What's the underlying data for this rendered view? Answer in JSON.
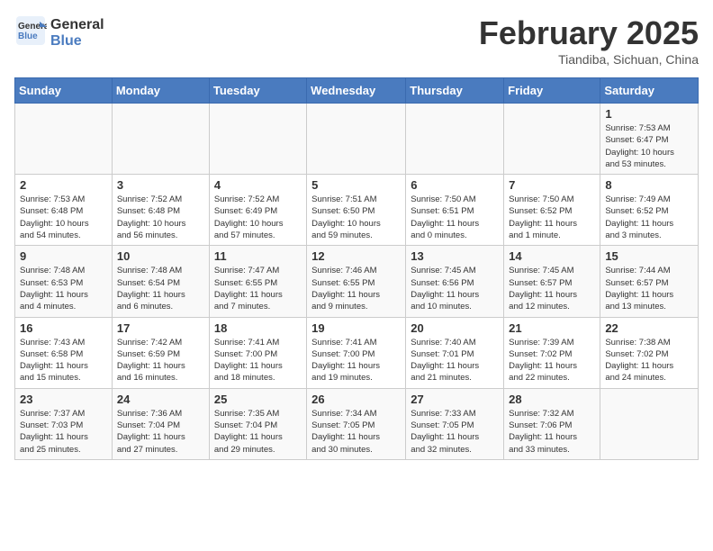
{
  "header": {
    "logo_line1": "General",
    "logo_line2": "Blue",
    "title": "February 2025",
    "subtitle": "Tiandiba, Sichuan, China"
  },
  "days_of_week": [
    "Sunday",
    "Monday",
    "Tuesday",
    "Wednesday",
    "Thursday",
    "Friday",
    "Saturday"
  ],
  "weeks": [
    [
      {
        "day": "",
        "info": ""
      },
      {
        "day": "",
        "info": ""
      },
      {
        "day": "",
        "info": ""
      },
      {
        "day": "",
        "info": ""
      },
      {
        "day": "",
        "info": ""
      },
      {
        "day": "",
        "info": ""
      },
      {
        "day": "1",
        "info": "Sunrise: 7:53 AM\nSunset: 6:47 PM\nDaylight: 10 hours\nand 53 minutes."
      }
    ],
    [
      {
        "day": "2",
        "info": "Sunrise: 7:53 AM\nSunset: 6:48 PM\nDaylight: 10 hours\nand 54 minutes."
      },
      {
        "day": "3",
        "info": "Sunrise: 7:52 AM\nSunset: 6:48 PM\nDaylight: 10 hours\nand 56 minutes."
      },
      {
        "day": "4",
        "info": "Sunrise: 7:52 AM\nSunset: 6:49 PM\nDaylight: 10 hours\nand 57 minutes."
      },
      {
        "day": "5",
        "info": "Sunrise: 7:51 AM\nSunset: 6:50 PM\nDaylight: 10 hours\nand 59 minutes."
      },
      {
        "day": "6",
        "info": "Sunrise: 7:50 AM\nSunset: 6:51 PM\nDaylight: 11 hours\nand 0 minutes."
      },
      {
        "day": "7",
        "info": "Sunrise: 7:50 AM\nSunset: 6:52 PM\nDaylight: 11 hours\nand 1 minute."
      },
      {
        "day": "8",
        "info": "Sunrise: 7:49 AM\nSunset: 6:52 PM\nDaylight: 11 hours\nand 3 minutes."
      }
    ],
    [
      {
        "day": "9",
        "info": "Sunrise: 7:48 AM\nSunset: 6:53 PM\nDaylight: 11 hours\nand 4 minutes."
      },
      {
        "day": "10",
        "info": "Sunrise: 7:48 AM\nSunset: 6:54 PM\nDaylight: 11 hours\nand 6 minutes."
      },
      {
        "day": "11",
        "info": "Sunrise: 7:47 AM\nSunset: 6:55 PM\nDaylight: 11 hours\nand 7 minutes."
      },
      {
        "day": "12",
        "info": "Sunrise: 7:46 AM\nSunset: 6:55 PM\nDaylight: 11 hours\nand 9 minutes."
      },
      {
        "day": "13",
        "info": "Sunrise: 7:45 AM\nSunset: 6:56 PM\nDaylight: 11 hours\nand 10 minutes."
      },
      {
        "day": "14",
        "info": "Sunrise: 7:45 AM\nSunset: 6:57 PM\nDaylight: 11 hours\nand 12 minutes."
      },
      {
        "day": "15",
        "info": "Sunrise: 7:44 AM\nSunset: 6:57 PM\nDaylight: 11 hours\nand 13 minutes."
      }
    ],
    [
      {
        "day": "16",
        "info": "Sunrise: 7:43 AM\nSunset: 6:58 PM\nDaylight: 11 hours\nand 15 minutes."
      },
      {
        "day": "17",
        "info": "Sunrise: 7:42 AM\nSunset: 6:59 PM\nDaylight: 11 hours\nand 16 minutes."
      },
      {
        "day": "18",
        "info": "Sunrise: 7:41 AM\nSunset: 7:00 PM\nDaylight: 11 hours\nand 18 minutes."
      },
      {
        "day": "19",
        "info": "Sunrise: 7:41 AM\nSunset: 7:00 PM\nDaylight: 11 hours\nand 19 minutes."
      },
      {
        "day": "20",
        "info": "Sunrise: 7:40 AM\nSunset: 7:01 PM\nDaylight: 11 hours\nand 21 minutes."
      },
      {
        "day": "21",
        "info": "Sunrise: 7:39 AM\nSunset: 7:02 PM\nDaylight: 11 hours\nand 22 minutes."
      },
      {
        "day": "22",
        "info": "Sunrise: 7:38 AM\nSunset: 7:02 PM\nDaylight: 11 hours\nand 24 minutes."
      }
    ],
    [
      {
        "day": "23",
        "info": "Sunrise: 7:37 AM\nSunset: 7:03 PM\nDaylight: 11 hours\nand 25 minutes."
      },
      {
        "day": "24",
        "info": "Sunrise: 7:36 AM\nSunset: 7:04 PM\nDaylight: 11 hours\nand 27 minutes."
      },
      {
        "day": "25",
        "info": "Sunrise: 7:35 AM\nSunset: 7:04 PM\nDaylight: 11 hours\nand 29 minutes."
      },
      {
        "day": "26",
        "info": "Sunrise: 7:34 AM\nSunset: 7:05 PM\nDaylight: 11 hours\nand 30 minutes."
      },
      {
        "day": "27",
        "info": "Sunrise: 7:33 AM\nSunset: 7:05 PM\nDaylight: 11 hours\nand 32 minutes."
      },
      {
        "day": "28",
        "info": "Sunrise: 7:32 AM\nSunset: 7:06 PM\nDaylight: 11 hours\nand 33 minutes."
      },
      {
        "day": "",
        "info": ""
      }
    ]
  ]
}
